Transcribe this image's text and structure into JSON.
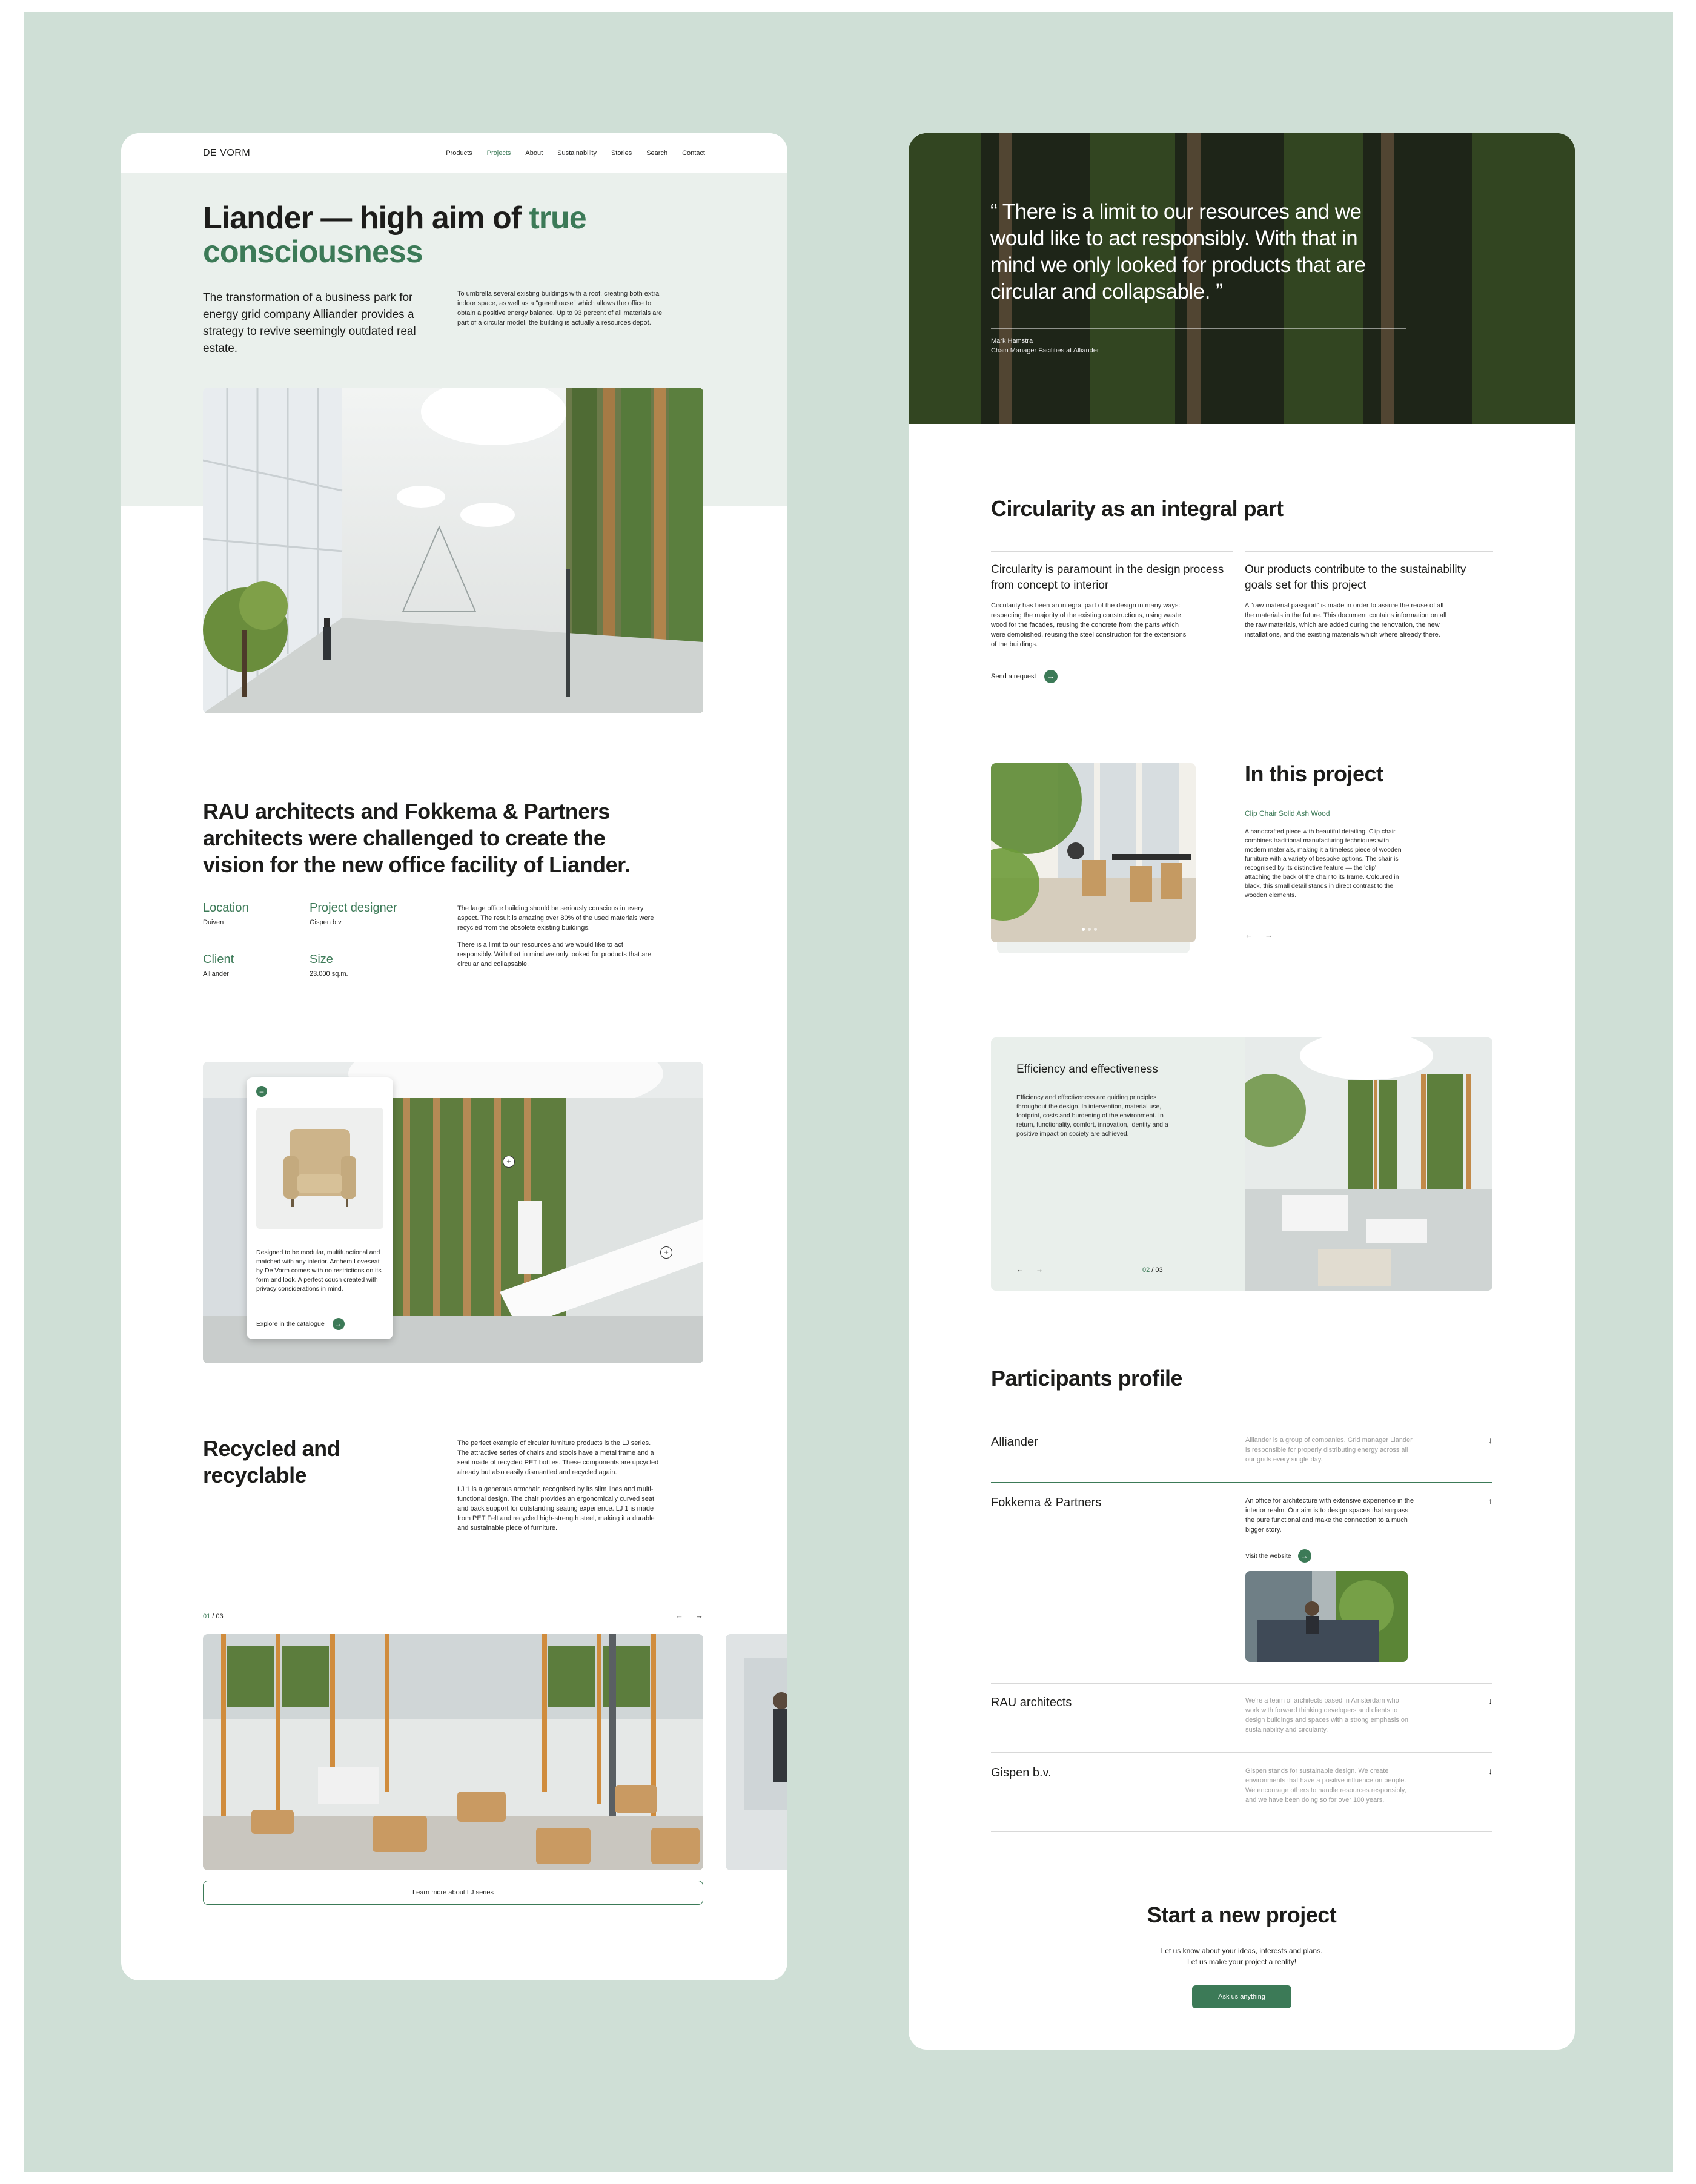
{
  "nav": {
    "logo": "DE VORM",
    "items": [
      "Products",
      "Projects",
      "About",
      "Sustainability",
      "Stories",
      "Search",
      "Contact"
    ],
    "active": "Projects"
  },
  "hero": {
    "title_part1": "Liander — high aim of ",
    "title_highlight": "true consciousness",
    "lead": "The transformation of a business park for energy grid company Alliander provides a strategy to revive seemingly outdated real estate.",
    "side_text": "To umbrella several existing buildings with a roof, creating both extra indoor space, as well as a \"greenhouse\" which allows the office to obtain a positive energy balance. Up to 93 percent of all materials are part of a circular model, the building is actually a resources depot."
  },
  "intro": {
    "heading": "RAU architects and Fokkema & Partners architects were challenged to create the vision for the new office facility of Liander.",
    "facts": [
      {
        "label": "Location",
        "value": "Duiven"
      },
      {
        "label": "Project designer",
        "value": "Gispen b.v"
      },
      {
        "label": "Client",
        "value": "Alliander"
      },
      {
        "label": "Size",
        "value": "23.000 sq.m."
      }
    ],
    "paragraph1": "The large office building should be seriously conscious in every aspect. The result is amazing over 80% of the used materials were recycled from the obsolete existing buildings.",
    "paragraph2": "There is a limit to our resources and we would like to act responsibly. With that in mind we only looked for products that are circular and collapsable."
  },
  "hotspot": {
    "popup_text": "Designed to be modular, multifunctional and matched with any interior. Arnhem Loveseat by De Vorm comes with no restrictions on its form and look. A perfect couch created with privacy considerations in mind.",
    "popup_link": "Explore in the catalogue",
    "close_glyph": "–",
    "plus_glyph": "+"
  },
  "recycled": {
    "heading": "Recycled and recyclable",
    "paragraph1": "The perfect example of circular furniture products is the LJ series. The attractive series of chairs and stools have a metal frame and a seat made of recycled PET bottles. These components are upcycled already but also easily dismantled and recycled again.",
    "paragraph2": "LJ 1 is a generous armchair, recognised by its slim lines and multi-functional design. The chair provides an ergonomically curved seat and back support for outstanding seating experience. LJ 1 is made from PET Felt and recycled high-strength steel, making it a durable and sustainable piece of furniture.",
    "counter_current": "01",
    "counter_total": " / 03",
    "button": "Learn more about LJ series"
  },
  "quote": {
    "text": "“ There is a limit to our resources and we would like to act responsibly. With that in mind we only looked for products that are circular and collapsable. ”",
    "author": "Mark Hamstra",
    "role": "Chain Manager Facilities at Alliander"
  },
  "circularity": {
    "heading": "Circularity as an integral part",
    "col1_title": "Circularity is paramount in the design process from concept to interior",
    "col1_text": "Circularity has been an integral part of the design in many ways: respecting the majority of the existing constructions, using waste wood for the facades, reusing the concrete from the parts which were demolished, reusing the steel construction for the extensions of the buildings.",
    "col2_title": "Our products contribute to the sustainability goals set for this project",
    "col2_text": "A \"raw material passport\" is made in order to assure the reuse of all the materials in the future. This document contains information on all the raw materials, which are added during the renovation, the new installations, and the existing materials which where already there.",
    "link": "Send a request"
  },
  "in_project": {
    "heading": "In this project",
    "product": "Clip Chair Solid Ash Wood",
    "text": "A handcrafted piece with beautiful detailing. Clip chair combines traditional manufacturing techniques with modern materials, making it a timeless piece of wooden furniture with a variety of bespoke options. The chair is recognised by its distinctive feature — the 'clip' attaching the back of the chair to its frame. Coloured in black, this small detail stands in direct contrast to the wooden elements."
  },
  "efficiency": {
    "heading": "Efficiency and effectiveness",
    "text": "Efficiency and effectiveness are guiding principles throughout the design. In intervention, material use, footprint, costs and burdening of the environment. In return, functionality, comfort, innovation, identity and a positive impact on society are achieved.",
    "counter_current": "02",
    "counter_total": " / 03"
  },
  "participants": {
    "heading": "Participants profile",
    "items": [
      {
        "name": "Alliander",
        "desc": "Alliander is a group of companies. Grid manager Liander is responsible for properly distributing energy across all our grids every single day.",
        "arrow": "↓"
      },
      {
        "name": "Fokkema & Partners",
        "desc": "An office for architecture with extensive experience in the interior realm. Our aim is to design spaces that surpass the pure functional and make the connection to a much bigger story.",
        "arrow": "↑",
        "link": "Visit the website"
      },
      {
        "name": "RAU architects",
        "desc": "We're a team of architects based in Amsterdam who work with forward thinking developers and clients to design buildings and spaces with a strong emphasis on sustainability and circularity.",
        "arrow": "↓"
      },
      {
        "name": "Gispen b.v.",
        "desc": "Gispen stands for sustainable design. We create environments that have a positive influence on people. We encourage others to handle resources responsibly, and we have been doing so for over 100 years.",
        "arrow": "↓"
      }
    ]
  },
  "cta": {
    "heading": "Start a new project",
    "line1": "Let us know about your ideas, interests and plans.",
    "line2": "Let us make your project a reality!",
    "button": "Ask us anything"
  },
  "icons": {
    "arrow_right": "→",
    "arrow_left": "←"
  },
  "colors": {
    "background": "#cfdfd6",
    "accent": "#3c7a57",
    "hero_band": "#eaf0ec"
  }
}
